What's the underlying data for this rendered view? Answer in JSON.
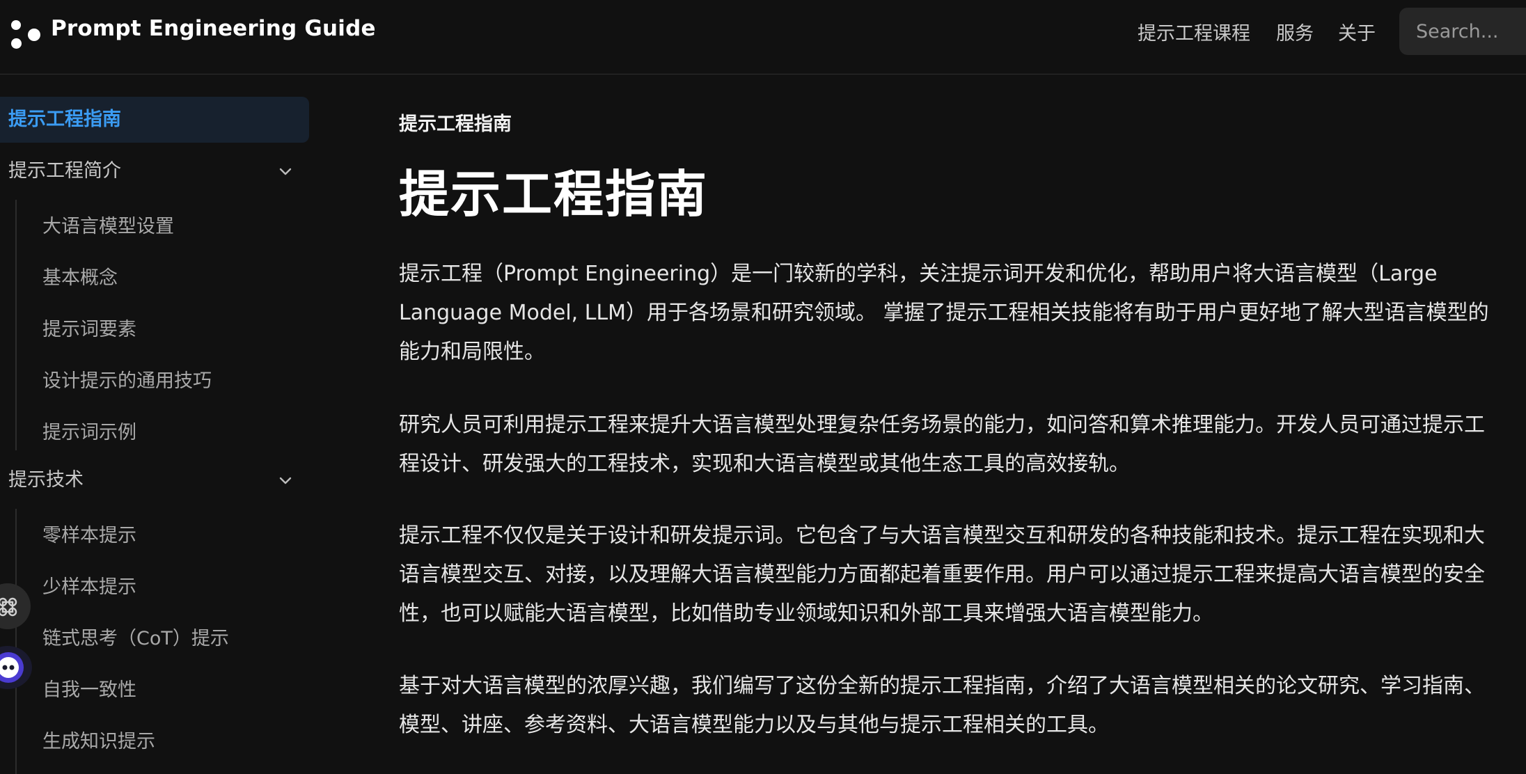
{
  "header": {
    "brand": "Prompt Engineering Guide",
    "nav": [
      "提示工程课程",
      "服务",
      "关于"
    ],
    "search_placeholder": "Search..."
  },
  "sidebar": {
    "active_item": "提示工程指南",
    "sections": [
      {
        "label": "提示工程简介",
        "expanded": true,
        "items": [
          "大语言模型设置",
          "基本概念",
          "提示词要素",
          "设计提示的通用技巧",
          "提示词示例"
        ]
      },
      {
        "label": "提示技术",
        "expanded": true,
        "items": [
          "零样本提示",
          "少样本提示",
          "链式思考（CoT）提示",
          "自我一致性",
          "生成知识提示"
        ]
      }
    ]
  },
  "main": {
    "breadcrumb": "提示工程指南",
    "title": "提示工程指南",
    "paragraphs": [
      "提示工程（Prompt Engineering）是一门较新的学科，关注提示词开发和优化，帮助用户将大语言模型（Large Language Model, LLM）用于各场景和研究领域。 掌握了提示工程相关技能将有助于用户更好地了解大型语言模型的能力和局限性。",
      "研究人员可利用提示工程来提升大语言模型处理复杂任务场景的能力，如问答和算术推理能力。开发人员可通过提示工程设计、研发强大的工程技术，实现和大语言模型或其他生态工具的高效接轨。",
      "提示工程不仅仅是关于设计和研发提示词。它包含了与大语言模型交互和研发的各种技能和技术。提示工程在实现和大语言模型交互、对接，以及理解大语言模型能力方面都起着重要作用。用户可以通过提示工程来提高大语言模型的安全性，也可以赋能大语言模型，比如借助专业领域知识和外部工具来增强大语言模型能力。",
      "基于对大语言模型的浓厚兴趣，我们编写了这份全新的提示工程指南，介绍了大语言模型相关的论文研究、学习指南、模型、讲座、参考资料、大语言模型能力以及与其他与提示工程相关的工具。"
    ]
  },
  "colors": {
    "background": "#111111",
    "accent": "#3b9cf3",
    "active_bg": "#17212e"
  },
  "icons": [
    "logo-icon",
    "chevron-down-icon",
    "command-icon",
    "assistant-icon"
  ]
}
